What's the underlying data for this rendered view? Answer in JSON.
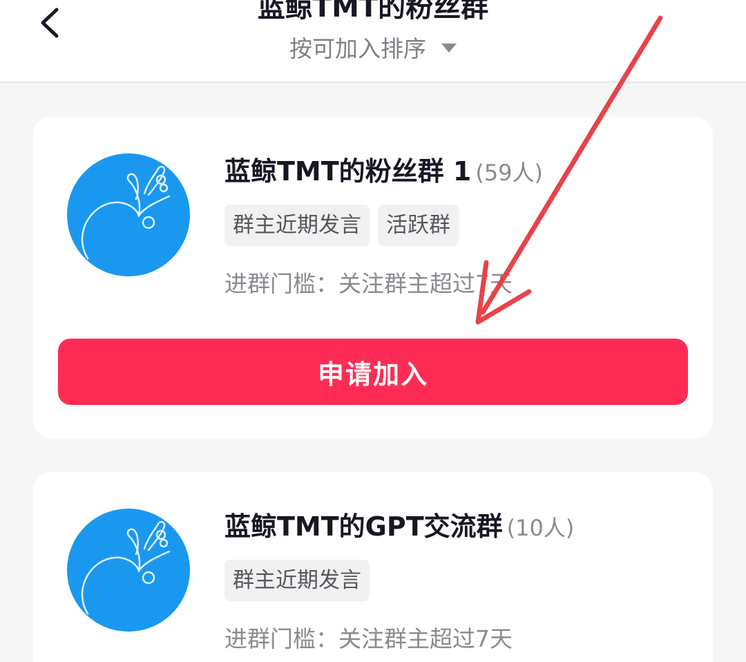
{
  "header": {
    "title": "蓝鲸TMT的粉丝群",
    "sort_label": "按可加入排序"
  },
  "groups": [
    {
      "name": "蓝鲸TMT的粉丝群 1",
      "member_count": "(59人)",
      "tags": [
        "群主近期发言",
        "活跃群"
      ],
      "threshold": "进群门槛：关注群主超过7天",
      "join_label": "申请加入"
    },
    {
      "name": "蓝鲸TMT的GPT交流群",
      "member_count": "(10人)",
      "tags": [
        "群主近期发言"
      ],
      "threshold": "进群门槛：关注群主超过7天"
    }
  ],
  "colors": {
    "accent": "#fe2c55",
    "avatar_blue": "#1a98f0",
    "annotation_arrow": "#e8424a"
  },
  "icons": {
    "back": "chevron-left-icon",
    "sort": "caret-down-icon",
    "avatar": "whale-logo-icon"
  }
}
